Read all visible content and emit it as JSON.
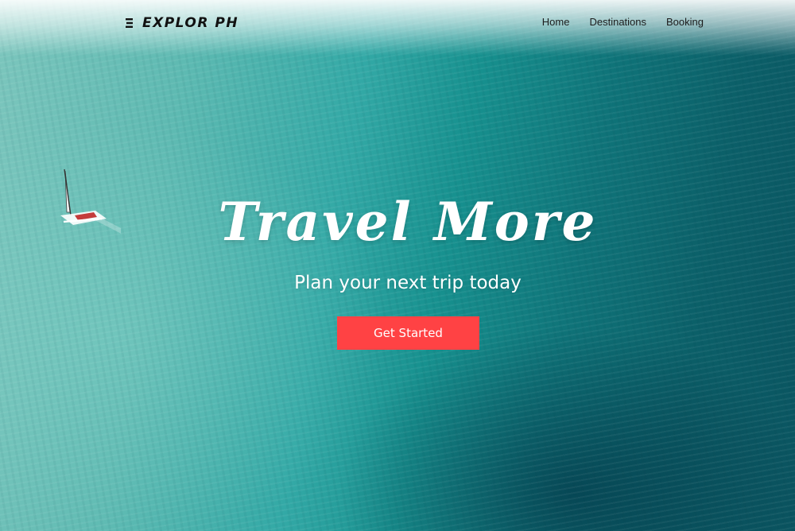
{
  "brand": {
    "logo_text": "EXPLOR PH",
    "logo_icon": "menu-lines-icon"
  },
  "nav": {
    "links": [
      {
        "label": "Home"
      },
      {
        "label": "Destinations"
      },
      {
        "label": "Booking"
      }
    ]
  },
  "hero": {
    "title": "Travel More",
    "subtitle": "Plan your next trip today",
    "cta_label": "Get Started",
    "background": "aerial-ocean-with-sailboat"
  },
  "colors": {
    "cta": "#ff4244",
    "text_light": "#ffffff",
    "text_dark": "#111111",
    "ocean_shallow": "#7cc6bd",
    "ocean_deep": "#0a5460"
  }
}
